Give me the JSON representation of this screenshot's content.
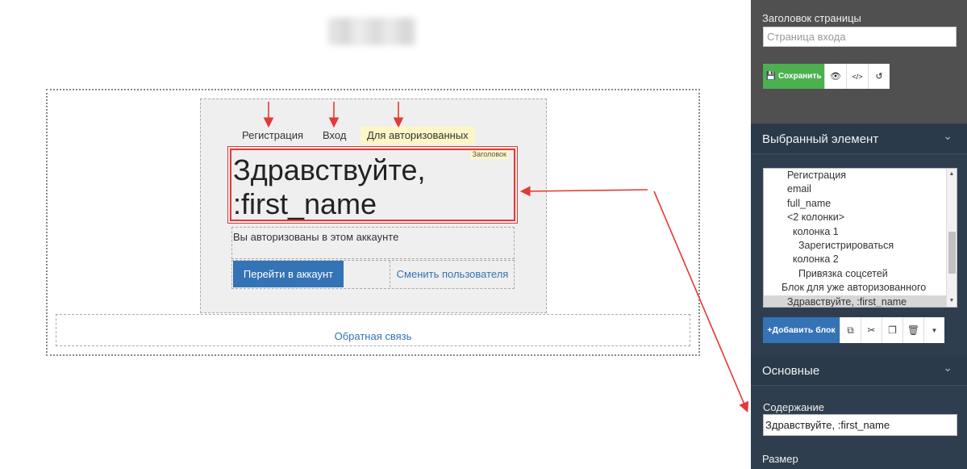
{
  "canvas": {
    "tabs": {
      "registration": "Регистрация",
      "login": "Вход",
      "authorized": "Для авторизованных"
    },
    "heading_tag": "Заголовок",
    "heading_text": "Здравствуйте,\n:first_name",
    "info_text": "Вы авторизованы в этом аккаунте",
    "go_to_account_button": "Перейти в аккаунт",
    "switch_user_link": "Сменить пользователя",
    "feedback_link": "Обратная связь"
  },
  "panel": {
    "page_title_label": "Заголовок страницы",
    "page_title_placeholder": "Страница входа",
    "save_button": "Сохранить",
    "selected_element_title": "Выбранный элемент",
    "tree_items": [
      {
        "label": "Регистрация",
        "indent": 2
      },
      {
        "label": "email",
        "indent": 2
      },
      {
        "label": "full_name",
        "indent": 2
      },
      {
        "label": "<2 колонки>",
        "indent": 2
      },
      {
        "label": "колонка 1",
        "indent": 3
      },
      {
        "label": "Зарегистрироваться",
        "indent": 4
      },
      {
        "label": "колонка 2",
        "indent": 3
      },
      {
        "label": "Привязка соцсетей",
        "indent": 4
      },
      {
        "label": "Блок для уже авторизованного",
        "indent": 1
      },
      {
        "label": "Здравствуйте, :first_name",
        "indent": 2,
        "selected": true
      }
    ],
    "add_block_button": "+Добавить блок",
    "basic_section_title": "Основные",
    "content_label": "Содержание",
    "content_value": "Здравствуйте, :first_name",
    "size_label": "Размер"
  },
  "colors": {
    "accent_blue": "#3473b5",
    "save_green": "#4cb04f",
    "annotation_red": "#e53935",
    "panel_bg": "#2f3e4f"
  }
}
